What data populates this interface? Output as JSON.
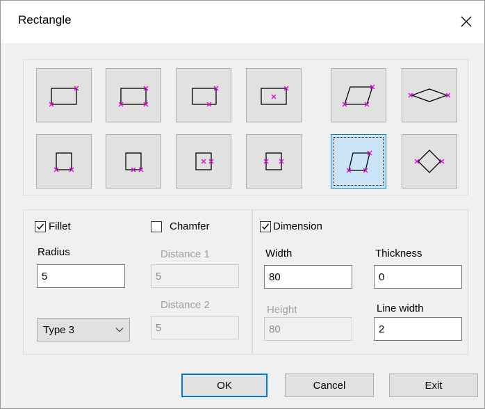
{
  "window": {
    "title": "Rectangle",
    "close_icon": "close-icon"
  },
  "shape_buttons": [
    {
      "name": "rect-two-corners",
      "selected": false
    },
    {
      "name": "rect-three-corners",
      "selected": false
    },
    {
      "name": "rect-corner-and-midpoint",
      "selected": false
    },
    {
      "name": "rect-center-and-corner",
      "selected": false
    },
    {
      "name": "parallelogram-three-points",
      "selected": false
    },
    {
      "name": "rhombus-horizontal",
      "selected": false
    },
    {
      "name": "square-two-bottom-corners",
      "selected": false
    },
    {
      "name": "square-bottom-midpoint",
      "selected": false
    },
    {
      "name": "square-center-and-side",
      "selected": false
    },
    {
      "name": "square-side-midpoints",
      "selected": false
    },
    {
      "name": "parallelogram-selected",
      "selected": true
    },
    {
      "name": "rhombus-diamond",
      "selected": false
    }
  ],
  "fillet": {
    "label": "Fillet",
    "checked": true,
    "radius_label": "Radius",
    "radius_value": "5",
    "type_value": "Type 3"
  },
  "chamfer": {
    "label": "Chamfer",
    "checked": false,
    "distance1_label": "Distance 1",
    "distance1_value": "5",
    "distance2_label": "Distance 2",
    "distance2_value": "5"
  },
  "dimension": {
    "label": "Dimension",
    "checked": true,
    "width_label": "Width",
    "width_value": "80",
    "height_label": "Height",
    "height_value": "80",
    "thickness_label": "Thickness",
    "thickness_value": "0",
    "line_width_label": "Line width",
    "line_width_value": "2"
  },
  "buttons": {
    "ok": "OK",
    "cancel": "Cancel",
    "exit": "Exit"
  },
  "colors": {
    "marker": "#e000e0",
    "accent": "#0078d7"
  }
}
